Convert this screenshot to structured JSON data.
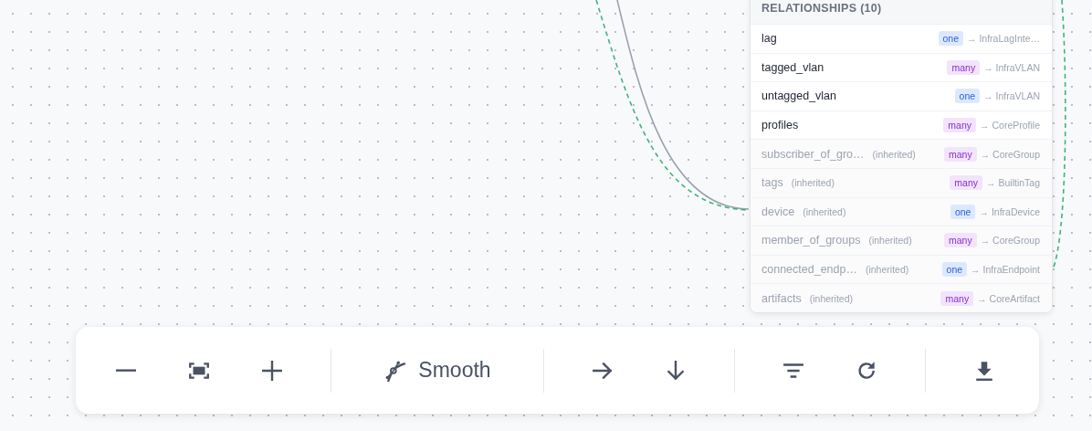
{
  "node_panel": {
    "section_title": "RELATIONSHIPS (10)",
    "relationships": [
      {
        "name": "lag",
        "inherited": false,
        "cardinality": "one",
        "peer": "→ InfraLagInte…"
      },
      {
        "name": "tagged_vlan",
        "inherited": false,
        "cardinality": "many",
        "peer": "→ InfraVLAN"
      },
      {
        "name": "untagged_vlan",
        "inherited": false,
        "cardinality": "one",
        "peer": "→ InfraVLAN"
      },
      {
        "name": "profiles",
        "inherited": false,
        "cardinality": "many",
        "peer": "→ CoreProfile"
      },
      {
        "name": "subscriber_of_gro…",
        "inherited": true,
        "note": "(inherited)",
        "cardinality": "many",
        "peer": "→ CoreGroup"
      },
      {
        "name": "tags",
        "inherited": true,
        "note": "(inherited)",
        "cardinality": "many",
        "peer": "→ BuiltinTag"
      },
      {
        "name": "device",
        "inherited": true,
        "note": "(inherited)",
        "cardinality": "one",
        "peer": "→ InfraDevice"
      },
      {
        "name": "member_of_groups",
        "inherited": true,
        "note": "(inherited)",
        "cardinality": "many",
        "peer": "→ CoreGroup"
      },
      {
        "name": "connected_endp…",
        "inherited": true,
        "note": "(inherited)",
        "cardinality": "one",
        "peer": "→ InfraEndpoint"
      },
      {
        "name": "artifacts",
        "inherited": true,
        "note": "(inherited)",
        "cardinality": "many",
        "peer": "→ CoreArtifact"
      }
    ]
  },
  "toolbar": {
    "groups": [
      [
        {
          "kind": "zoom-out"
        },
        {
          "kind": "fit"
        },
        {
          "kind": "zoom-in"
        }
      ],
      [
        {
          "kind": "smooth",
          "label": "Smooth"
        }
      ],
      [
        {
          "kind": "horizontal"
        },
        {
          "kind": "vertical"
        }
      ],
      [
        {
          "kind": "filter"
        },
        {
          "kind": "refresh"
        }
      ],
      [
        {
          "kind": "download"
        }
      ]
    ]
  }
}
